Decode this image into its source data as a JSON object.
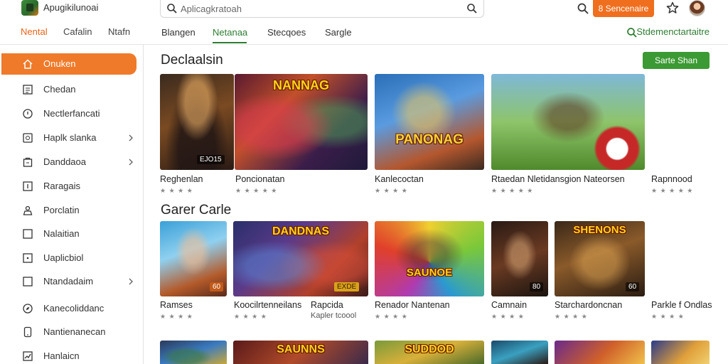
{
  "header": {
    "app_title": "Apugikilunoai",
    "search_placeholder": "Aplicagkratoah",
    "primary_button": "8 Sencenaire"
  },
  "left_tabs": [
    "Nental",
    "Cafalin",
    "Ntafn"
  ],
  "main_tabs": [
    "Blangen",
    "Netanaa",
    "Stecqoes",
    "Sargle"
  ],
  "right_link": "Stdemenctartaitre",
  "sidebar": {
    "items": [
      {
        "label": "Onuken",
        "icon": "home-icon",
        "chevron": false
      },
      {
        "label": "Chedan",
        "icon": "list-icon",
        "chevron": false
      },
      {
        "label": "Nectlerfancati",
        "icon": "clock-icon",
        "chevron": false
      },
      {
        "label": "Haplk slanka",
        "icon": "apps-icon",
        "chevron": true
      },
      {
        "label": "Danddaoa",
        "icon": "bag-icon",
        "chevron": true
      },
      {
        "label": "Raragais",
        "icon": "download-icon",
        "chevron": false
      },
      {
        "label": "Porclatin",
        "icon": "user-group-icon",
        "chevron": false
      },
      {
        "label": "Nalaitian",
        "icon": "square-icon",
        "chevron": false
      },
      {
        "label": "Uaplicbiol",
        "icon": "dot-square-icon",
        "chevron": false
      },
      {
        "label": "Ntandadaim",
        "icon": "folder-icon",
        "chevron": true
      },
      {
        "label": "Kanecoliddanc",
        "icon": "compass-icon",
        "chevron": false
      },
      {
        "label": "Nantienanecan",
        "icon": "phone-icon",
        "chevron": false
      },
      {
        "label": "Hanlaicn",
        "icon": "chart-icon",
        "chevron": false
      }
    ]
  },
  "sections": [
    {
      "title": "Declaalsin",
      "see_all": "Sarte Shan",
      "cards": [
        {
          "name": "Reghenlan",
          "rating": "★ ★ ★ ★",
          "banner": "",
          "tag": "EJO15"
        },
        {
          "name": "Poncionatan",
          "rating": "★ ★ ★ ★ ★",
          "banner": "NANNAG",
          "tag": ""
        },
        {
          "name": "Kanlecoctan",
          "rating": "★ ★ ★ ★",
          "banner": "PANONAG",
          "tag": ""
        },
        {
          "name": "Rtaedan Nletidansgion  Nateorsen",
          "rating": "★ ★ ★ ★ ★",
          "banner": "",
          "tag": ""
        },
        {
          "name": "Rapnnood",
          "rating": "★ ★ ★ ★ ★",
          "banner": "",
          "tag": ""
        }
      ]
    },
    {
      "title": "Garer Carle",
      "see_all": "",
      "cards": [
        {
          "name": "Ramses",
          "sub": "",
          "rating": "★ ★ ★ ★",
          "banner": "",
          "tag": "60"
        },
        {
          "name": "Koocilrtenneilans",
          "sub": "",
          "rating": "★ ★ ★ ★",
          "banner": "DANDNAS",
          "tag": "EXDE"
        },
        {
          "name": "Rapcida",
          "sub": "Kapler tcoool",
          "rating": "",
          "banner": "",
          "tag": ""
        },
        {
          "name": "Renador Nantenan",
          "sub": "",
          "rating": "★ ★ ★ ★",
          "banner": "SAUNOE",
          "tag": ""
        },
        {
          "name": "Camnain",
          "sub": "",
          "rating": "★ ★ ★ ★",
          "banner": "",
          "tag": "80"
        },
        {
          "name": "Starchardoncnan",
          "sub": "",
          "rating": "★ ★ ★ ★",
          "banner": "SHENONS",
          "tag": "60"
        },
        {
          "name": "Parkle f Ondlas",
          "sub": "",
          "rating": "★ ★ ★ ★",
          "banner": "",
          "tag": ""
        }
      ]
    },
    {
      "title": "",
      "cards": [
        {
          "banner": ""
        },
        {
          "banner": "SAUNNS"
        },
        {
          "banner": "SUDDOD"
        },
        {
          "banner": ""
        },
        {
          "banner": ""
        },
        {
          "banner": ""
        }
      ]
    }
  ],
  "colors": {
    "accent_orange": "#ef6f1f",
    "accent_green": "#2e7d32",
    "button_green": "#3b9a33"
  }
}
